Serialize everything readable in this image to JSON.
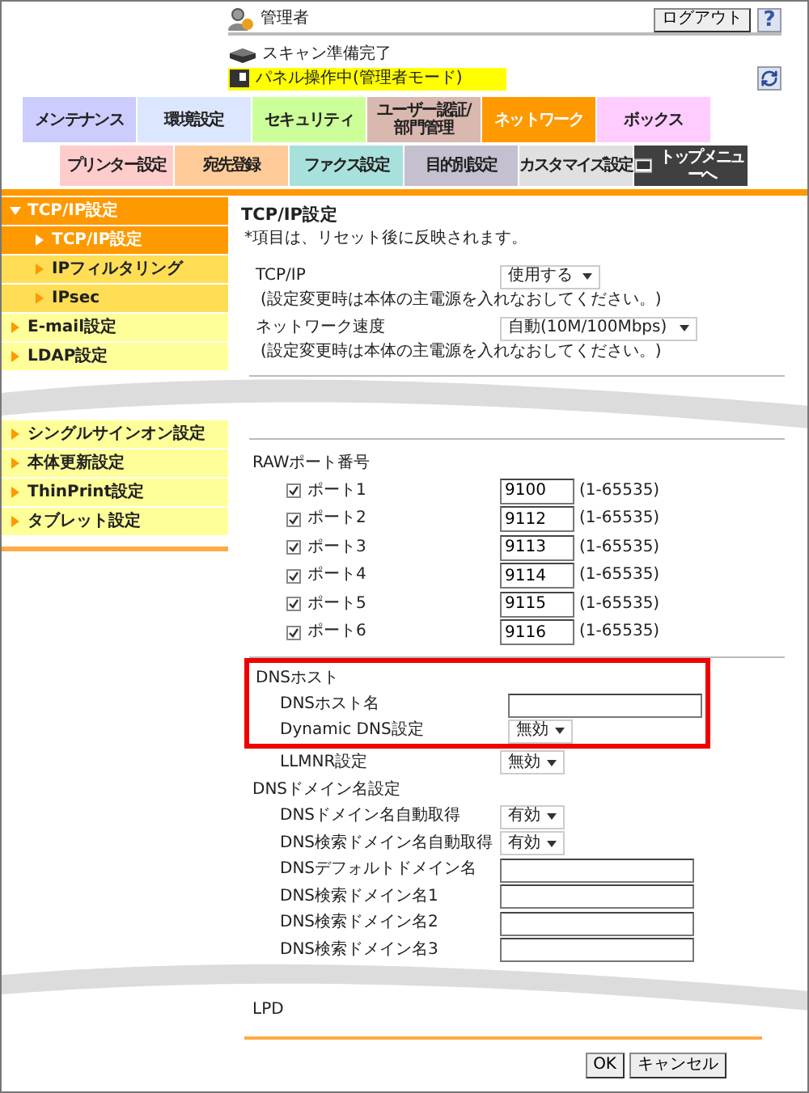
{
  "header": {
    "user": "管理者",
    "logout": "ログアウト",
    "help": "?"
  },
  "status": {
    "scan": "スキャン準備完了",
    "panel": "パネル操作中(管理者モード)"
  },
  "main_tabs": [
    {
      "label": "メンテナンス",
      "selected": false,
      "color": "#ccccff"
    },
    {
      "label": "環境設定",
      "selected": false,
      "color": "#dde6ff"
    },
    {
      "label": "セキュリティ",
      "selected": false,
      "color": "#ccff99"
    },
    {
      "label": "ユーザー認証/部門管理",
      "selected": false,
      "color": "#d9b8b0"
    },
    {
      "label": "ネットワーク",
      "selected": true,
      "color": "#ff9900"
    },
    {
      "label": "ボックス",
      "selected": false,
      "color": "#ffccff"
    }
  ],
  "sub_tabs": [
    {
      "kind": "tab",
      "label": "プリンター設定",
      "color": "#ffcccc"
    },
    {
      "kind": "tab",
      "label": "宛先登録",
      "color": "#ffcc99"
    },
    {
      "kind": "tab",
      "label": "ファクス設定",
      "color": "#a8e0dc"
    },
    {
      "kind": "tab",
      "label": "目的別設定",
      "color": "#c4c0d0"
    },
    {
      "kind": "tab",
      "label": "カスタマイズ設定",
      "color": "#e0e0e0"
    },
    {
      "kind": "top",
      "label": "トップメニューへ",
      "color": "#404040"
    }
  ],
  "sidebar": {
    "items": [
      {
        "label": "TCP/IP設定",
        "expanded": true,
        "children": [
          {
            "label": "TCP/IP設定",
            "selected": true
          },
          {
            "label": "IPフィルタリング",
            "selected": false
          },
          {
            "label": "IPsec",
            "selected": false
          }
        ]
      },
      {
        "label": "E-mail設定",
        "expanded": false
      },
      {
        "label": "LDAP設定",
        "expanded": false
      },
      {
        "label": "シングルサインオン設定",
        "expanded": false
      },
      {
        "label": "本体更新設定",
        "expanded": false
      },
      {
        "label": "ThinPrint設定",
        "expanded": false
      },
      {
        "label": "タブレット設定",
        "expanded": false
      }
    ]
  },
  "content": {
    "title": "TCP/IP設定",
    "note": "*項目は、リセット後に反映されます。",
    "settings": [
      {
        "label": "TCP/IP",
        "value": "使用する",
        "hint": "(設定変更時は本体の主電源を入れなおしてください。)",
        "wide": false
      },
      {
        "label": "ネットワーク速度",
        "value": "自動(10M/100Mbps)",
        "hint": "(設定変更時は本体の主電源を入れなおしてください。)",
        "wide": true
      }
    ],
    "raw_ports": {
      "title": "RAWポート番号",
      "ports": [
        {
          "label": "ポート1",
          "checked": true,
          "value": "9100",
          "range": "(1-65535)"
        },
        {
          "label": "ポート2",
          "checked": true,
          "value": "9112",
          "range": "(1-65535)"
        },
        {
          "label": "ポート3",
          "checked": true,
          "value": "9113",
          "range": "(1-65535)"
        },
        {
          "label": "ポート4",
          "checked": true,
          "value": "9114",
          "range": "(1-65535)"
        },
        {
          "label": "ポート5",
          "checked": true,
          "value": "9115",
          "range": "(1-65535)"
        },
        {
          "label": "ポート6",
          "checked": true,
          "value": "9116",
          "range": "(1-65535)"
        }
      ]
    },
    "dns_host": {
      "title": "DNSホスト",
      "highlighted": true,
      "rows": [
        {
          "kind": "text",
          "label": "DNSホスト名"
        },
        {
          "kind": "select",
          "label": "Dynamic DNS設定",
          "value": "無効"
        }
      ]
    },
    "llmnr": {
      "kind": "select",
      "label": "LLMNR設定",
      "value": "無効"
    },
    "dns_domain": {
      "title": "DNSドメイン名設定",
      "rows": [
        {
          "kind": "select",
          "label": "DNSドメイン名自動取得",
          "value": "有効"
        },
        {
          "kind": "select",
          "label": "DNS検索ドメイン名自動取得",
          "value": "有効"
        },
        {
          "kind": "text",
          "label": "DNSデフォルトドメイン名"
        },
        {
          "kind": "text",
          "label": "DNS検索ドメイン名1"
        },
        {
          "kind": "text",
          "label": "DNS検索ドメイン名2"
        },
        {
          "kind": "text",
          "label": "DNS検索ドメイン名3"
        }
      ]
    },
    "lpd": "LPD",
    "buttons": {
      "ok": "OK",
      "cancel": "キャンセル"
    }
  }
}
